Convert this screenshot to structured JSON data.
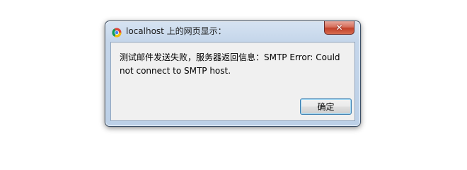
{
  "dialog": {
    "title": "localhost 上的网页显示：",
    "message": "测试邮件发送失败，服务器返回信息：SMTP Error: Could not connect to SMTP host.",
    "ok_label": "确定",
    "close_symbol": "✕",
    "icon": "chrome-icon"
  },
  "colors": {
    "frame": "#c5d6ea",
    "close_button": "#c2412a",
    "content_bg": "#f0f0f0",
    "ok_border": "#3c7fb1"
  }
}
